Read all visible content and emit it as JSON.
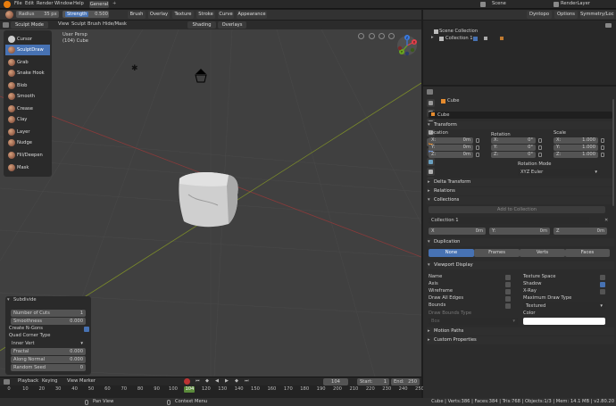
{
  "menu": {
    "file": "File",
    "edit": "Edit",
    "render": "Render",
    "window": "Window",
    "help": "Help",
    "workspace": "General",
    "scene": "Scene",
    "renderlayer": "RenderLayer"
  },
  "toolheader": {
    "radius_label": "Radius",
    "radius_value": "35 px",
    "strength_label": "Strength",
    "strength_value": "0.500",
    "brush": "Brush",
    "overlay": "Overlay",
    "texture": "Texture",
    "stroke": "Stroke",
    "curve": "Curve",
    "appearance": "Appearance",
    "dyntopo": "Dyntopo",
    "options": "Options",
    "symmetry": "Symmetry/Lock"
  },
  "viewheader": {
    "mode": "Sculpt Mode",
    "view": "View",
    "sculpt": "Sculpt",
    "brush": "Brush",
    "hidemask": "Hide/Mask",
    "shading": "Shading",
    "overlays": "Overlays"
  },
  "viewport": {
    "line1": "User Persp",
    "line2": "(104) Cube"
  },
  "gizmo": {
    "x": "X",
    "y": "Y",
    "z": "Z"
  },
  "tools": [
    "Cursor",
    "SculptDraw",
    "Grab",
    "Snake Hook",
    "Blob",
    "Smooth",
    "Crease",
    "Clay",
    "Layer",
    "Nudge",
    "Fill/Deepen",
    "Mask"
  ],
  "redo": {
    "title": "Subdivide",
    "cuts_label": "Number of Cuts",
    "cuts_value": "1",
    "smooth_label": "Smoothness",
    "smooth_value": "0.000",
    "ngons_label": "Create N-Gons",
    "quad_label": "Quad Corner Type",
    "quad_value": "Inner Vert",
    "fractal_label": "Fractal",
    "fractal_value": "0.000",
    "normal_label": "Along Normal",
    "normal_value": "0.000",
    "seed_label": "Random Seed",
    "seed_value": "0"
  },
  "timeline": {
    "playback": "Playback",
    "keying": "Keying",
    "view": "View",
    "marker": "Marker",
    "current": "104",
    "start_label": "Start:",
    "start_value": "1",
    "end_label": "End:",
    "end_value": "250",
    "ticks": [
      "0",
      "10",
      "20",
      "30",
      "40",
      "50",
      "60",
      "70",
      "80",
      "90",
      "100",
      "104",
      "120",
      "130",
      "140",
      "150",
      "160",
      "170",
      "180",
      "190",
      "200",
      "210",
      "220",
      "230",
      "240",
      "250"
    ]
  },
  "status": {
    "left": "Pan View",
    "mid": "Context Menu",
    "right": "Cube | Verts:386 | Faces:384 | Tris:768 | Objects:1/3 | Mem: 14.1 MB | v2.80.20"
  },
  "outliner": {
    "root": "Scene Collection",
    "child": "Collection 1"
  },
  "props": {
    "header": "Cube",
    "objname": "Cube",
    "transform": "Transform",
    "location": "Location",
    "rotation": "Rotation",
    "scale": "Scale",
    "loc": [
      {
        "axis": "X:",
        "val": "0m"
      },
      {
        "axis": "Y:",
        "val": "0m"
      },
      {
        "axis": "Z:",
        "val": "0m"
      }
    ],
    "rot": [
      {
        "axis": "X:",
        "val": "0°"
      },
      {
        "axis": "Y:",
        "val": "0°"
      },
      {
        "axis": "Z:",
        "val": "0°"
      }
    ],
    "scl": [
      {
        "axis": "X:",
        "val": "1.000"
      },
      {
        "axis": "Y:",
        "val": "1.000"
      },
      {
        "axis": "Z:",
        "val": "1.000"
      }
    ],
    "rotmode_label": "Rotation Mode",
    "rotmode_value": "XYZ Euler",
    "delta": "Delta Transform",
    "relations": "Relations",
    "collections": "Collections",
    "add_collection": "Add to Collection",
    "coll_name": "Collection 1",
    "coll_x": "X",
    "coll_xv": "0m",
    "coll_y": "Y:",
    "coll_yv": "0m",
    "coll_z": "Z",
    "coll_zv": "0m",
    "duplication": "Duplication",
    "dup_none": "None",
    "dup_frames": "Frames",
    "dup_verts": "Verts",
    "dup_faces": "Faces",
    "viewport_display": "Viewport Display",
    "vd_name": "Name",
    "vd_axis": "Axis",
    "vd_wire": "Wireframe",
    "vd_alledges": "Draw All Edges",
    "vd_bounds": "Bounds",
    "vd_texspace": "Texture Space",
    "vd_shadow": "Shadow",
    "vd_xray": "X-Ray",
    "vd_maxdraw": "Maximum Draw Type",
    "vd_maxdraw_value": "Textured",
    "vd_boundstype": "Draw Bounds Type",
    "vd_boundstype_value": "Box",
    "vd_color": "Color",
    "motion": "Motion Paths",
    "custom": "Custom Properties"
  }
}
